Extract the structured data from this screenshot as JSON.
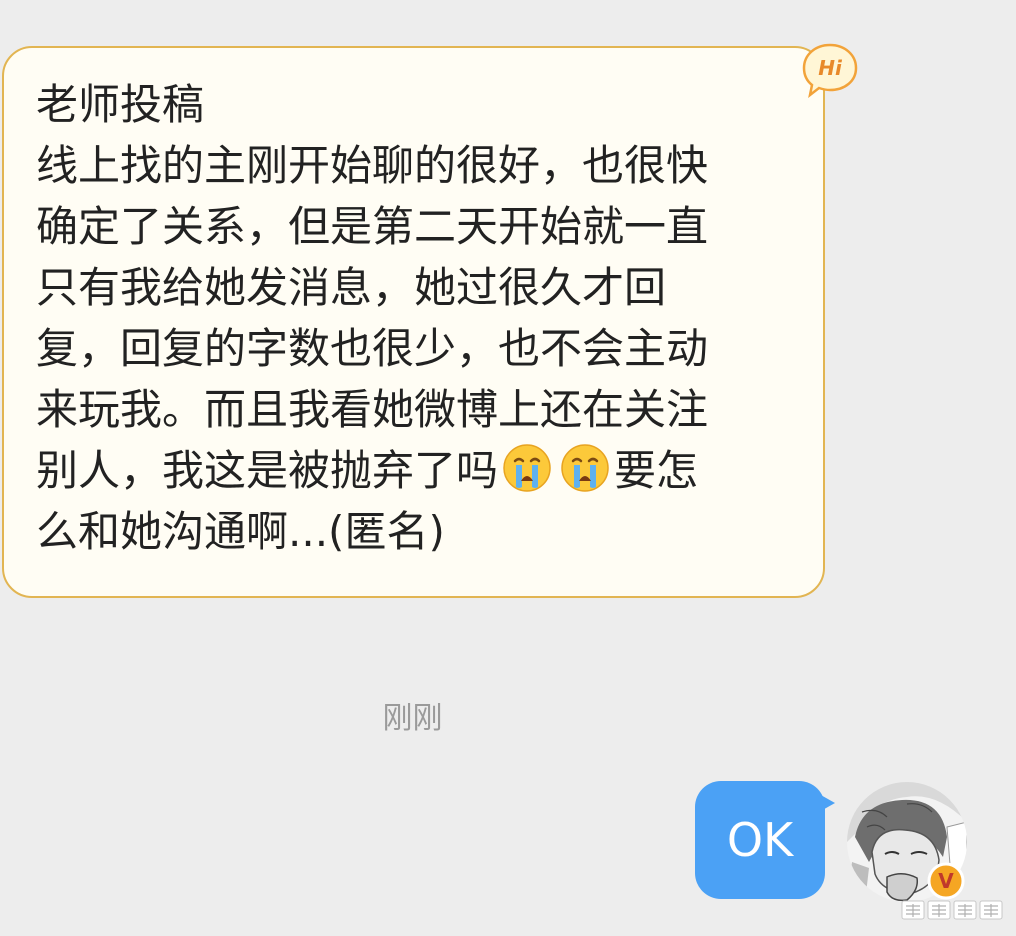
{
  "conversation": {
    "incoming": {
      "title": "老师投稿",
      "body_part1": "线上找的主刚开始聊的很好，也很快\n确定了关系，但是第二天开始就一直\n只有我给她发消息，她过很久才回\n复，回复的字数也很少，也不会主动\n来玩我。而且我看她微博上还在关注\n别人，我这是被抛弃了吗",
      "body_part2": "要怎\n么和她沟通啊...(匿名)",
      "emojis": [
        "crying-face",
        "crying-face"
      ],
      "badge": "Hi"
    },
    "timestamp": "刚刚",
    "outgoing": {
      "text": "OK"
    },
    "avatar": {
      "badge": "V"
    }
  },
  "colors": {
    "page_background": "#ededed",
    "incoming_bubble_fill": "#fffdf4",
    "incoming_bubble_border": "#e2b552",
    "outgoing_bubble": "#4ba1f5",
    "timestamp_text": "#9a9a9a",
    "badge_orange": "#f2a33a",
    "verified_badge": "#f5a623"
  },
  "icons": {
    "hi_badge": "hi-speech-bubble-icon",
    "emoji": "loudly-crying-face-icon",
    "verified": "verified-v-badge-icon",
    "watermark": "weibo-watermark-icon"
  }
}
